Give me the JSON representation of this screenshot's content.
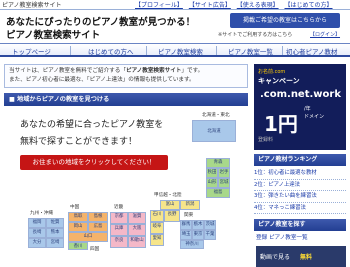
{
  "header": {
    "tagline": "ピアノ教室検索サイト",
    "links": [
      "【プロフィール】",
      "【サイト広告】",
      "【使える表現】",
      "【はじめての方】"
    ],
    "title_line1": "あなたにぴったりのピアノ教室が見つかる！",
    "title_line2": "ピアノ教室検索サイト",
    "cta": "掲載ご希望の教室はこちらから",
    "note": "※サイトでご利用する方はこちら",
    "login": "【ログイン】"
  },
  "nav": {
    "items": [
      "トップページ",
      "はじめての方へ",
      "ピアノ教室検索",
      "ピアノ教室一覧",
      "初心者ピアノ教材"
    ]
  },
  "about": {
    "line1a": "当サイトは、ピアノ教室を無料でご紹介する「",
    "line1b": "ピアノ教室検索サイト",
    "line1c": "」です。",
    "line2": "また、ピアノ初心者に最適な、「ピアノ上達法」の情報も提供しています。"
  },
  "section": {
    "title": "■ 地域からピアノの教室を見つける"
  },
  "hero": {
    "line1": "あなたの希望に合ったピアノ教室を",
    "line2": "無料で探すことができます！",
    "button": "お住まいの地域をクリックしてください！"
  },
  "map": {
    "regions": [
      {
        "label": "北海道・東北",
        "name": "北海道"
      },
      {
        "label": "",
        "name": "青森"
      },
      {
        "label": "",
        "name": "秋田"
      },
      {
        "label": "",
        "name": "岩手"
      },
      {
        "label": "",
        "name": "山形"
      },
      {
        "label": "",
        "name": "宮城"
      },
      {
        "label": "",
        "name": "福島"
      },
      {
        "label": "中部",
        "name": "新潟"
      },
      {
        "label": "",
        "name": "富山"
      },
      {
        "label": "",
        "name": "石川"
      },
      {
        "label": "",
        "name": "長野"
      },
      {
        "label": "",
        "name": "岐阜"
      },
      {
        "label": "",
        "name": "愛知"
      },
      {
        "label": "関東",
        "name": "群馬"
      },
      {
        "label": "",
        "name": "栃木"
      },
      {
        "label": "",
        "name": "茨城"
      },
      {
        "label": "",
        "name": "埼玉"
      },
      {
        "label": "",
        "name": "東京"
      },
      {
        "label": "",
        "name": "千葉"
      },
      {
        "label": "",
        "name": "神奈川"
      },
      {
        "label": "近畿",
        "name": "京都"
      },
      {
        "label": "",
        "name": "滋賀"
      },
      {
        "label": "",
        "name": "兵庫"
      },
      {
        "label": "",
        "name": "大阪"
      },
      {
        "label": "",
        "name": "奈良"
      },
      {
        "label": "",
        "name": "和歌山"
      },
      {
        "label": "中国",
        "name": "鳥取"
      },
      {
        "label": "",
        "name": "島根"
      },
      {
        "label": "",
        "name": "岡山"
      },
      {
        "label": "",
        "name": "広島"
      },
      {
        "label": "",
        "name": "山口"
      },
      {
        "label": "四国",
        "name": "香川"
      },
      {
        "label": "",
        "name": "愛媛"
      },
      {
        "label": "九州・沖縄",
        "name": "福岡"
      },
      {
        "label": "",
        "name": "佐賀"
      },
      {
        "label": "",
        "name": "長崎"
      },
      {
        "label": "",
        "name": "熊本"
      },
      {
        "label": "",
        "name": "大分"
      },
      {
        "label": "",
        "name": "宮崎"
      }
    ],
    "group_labels": [
      "北海道・東北",
      "甲信越・北陸",
      "関東",
      "中国",
      "近畿",
      "四国",
      "九州・沖縄"
    ]
  },
  "ad1": {
    "line1": "お名前.com",
    "line2": "キャンペーン",
    "line3": ".com.net.work",
    "price": "1円",
    "unit1": "/年",
    "unit2": "ドメイン",
    "line4": "登録料"
  },
  "ranking": {
    "title": "ピアノ教材ランキング",
    "items": [
      "1位：初心者に最適な教材",
      "2位：ピアノ上達法",
      "3位：弾きたい曲を練習法",
      "4位：マネっこ練習法"
    ]
  },
  "find": {
    "title": "ピアノ教室を探す",
    "link": "登録 ピアノ教室一覧"
  },
  "ad2": {
    "text": "動画で見る",
    "badge": "無料"
  },
  "colors": {
    "nav": "#2d4a9e",
    "accent_red": "#c51515",
    "map_orange": "#f4b36b",
    "map_green": "#a8d88a",
    "map_blue": "#a9c8ea",
    "map_yellow": "#f6e58a",
    "map_pink": "#f4b8c8"
  }
}
